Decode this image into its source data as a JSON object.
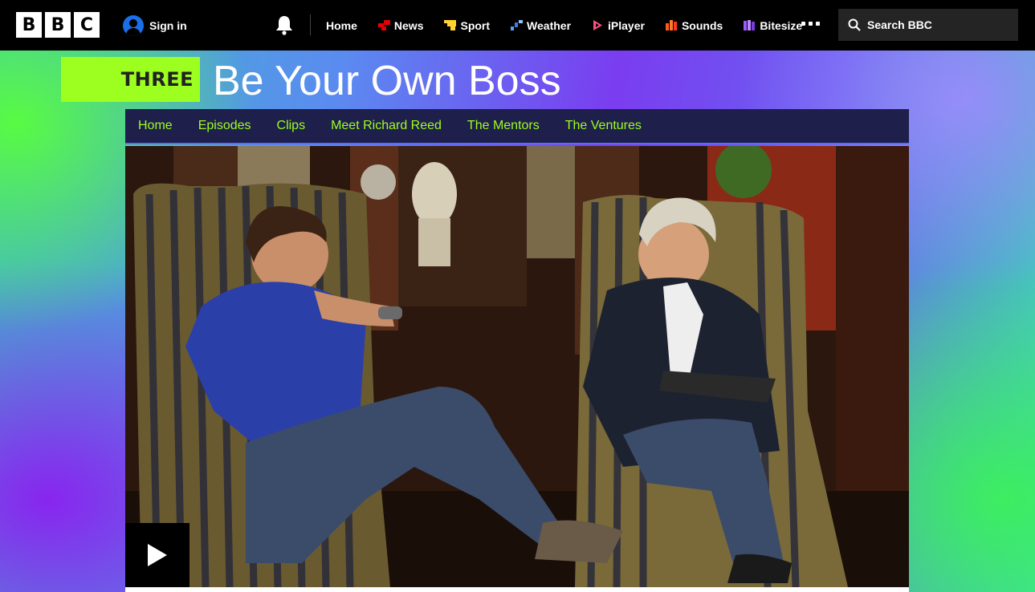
{
  "bbc": {
    "logo_letters": [
      "B",
      "B",
      "C"
    ],
    "sign_in": "Sign in",
    "nav": [
      {
        "label": "Home",
        "icon": "none",
        "color": ""
      },
      {
        "label": "News",
        "icon": "news-icon",
        "color": "#e60000"
      },
      {
        "label": "Sport",
        "icon": "sport-icon",
        "color": "#ffd230"
      },
      {
        "label": "Weather",
        "icon": "weather-icon",
        "color": "#5aa0ff"
      },
      {
        "label": "iPlayer",
        "icon": "iplayer-icon",
        "color": "#ff4e80"
      },
      {
        "label": "Sounds",
        "icon": "sounds-icon",
        "color": "#ff5a1e"
      },
      {
        "label": "Bitesize",
        "icon": "bitesize-icon",
        "color": "#9a5cff"
      }
    ],
    "search_label": "Search BBC"
  },
  "show": {
    "channel": "THREE",
    "title": "Be Your Own Boss",
    "channel_color": "#9cff1f"
  },
  "subnav": [
    "Home",
    "Episodes",
    "Clips",
    "Meet Richard Reed",
    "The Mentors",
    "The Ventures"
  ],
  "video": {
    "play_icon": "play-icon"
  }
}
